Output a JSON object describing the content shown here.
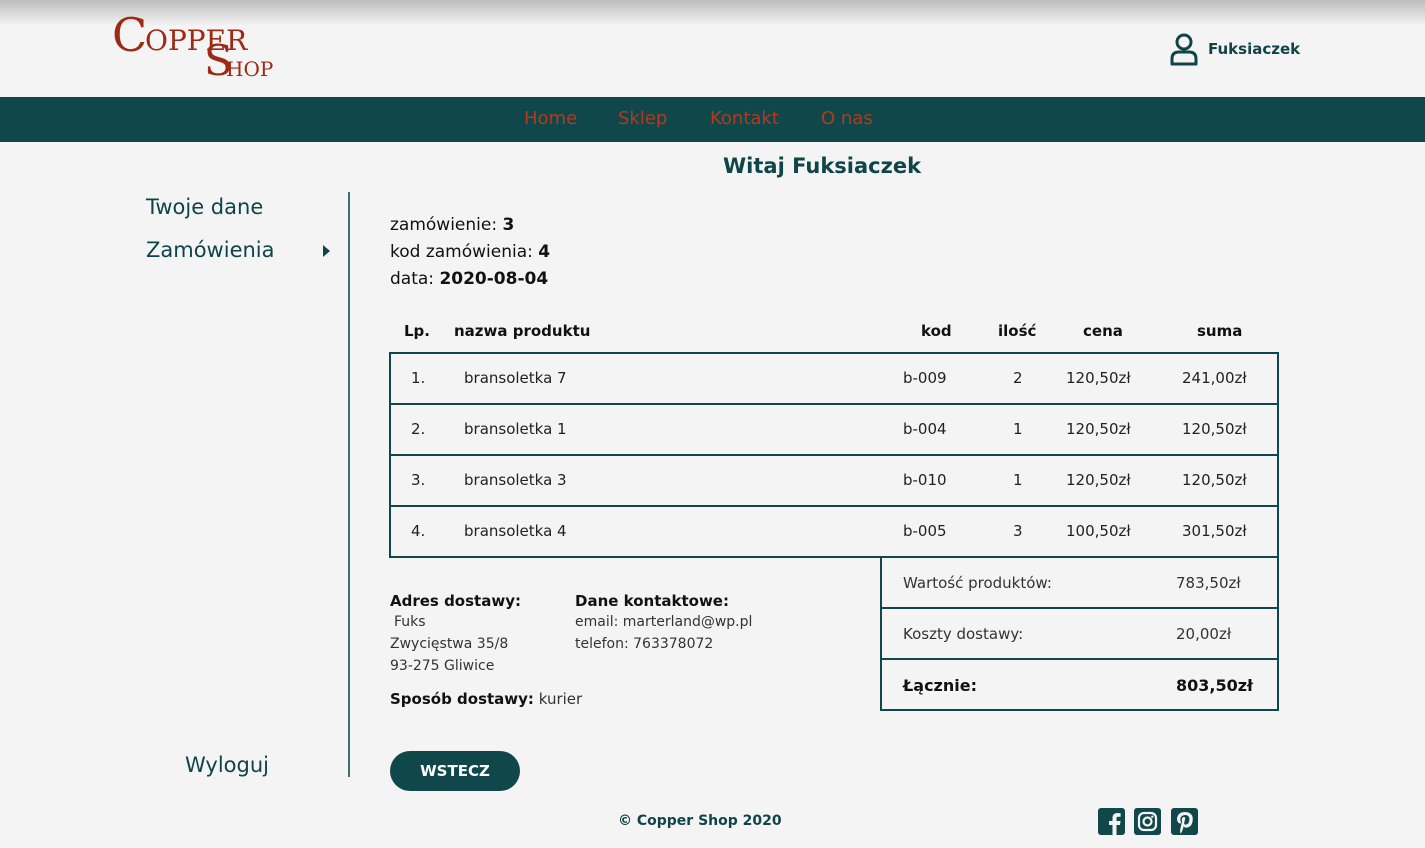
{
  "brand": {
    "logo_c": "C",
    "logo_opper": "OPPER",
    "logo_s": "S",
    "logo_hop": "HOP"
  },
  "header": {
    "username": "Fuksiaczek"
  },
  "nav": [
    "Home",
    "Sklep",
    "Kontakt",
    "O nas"
  ],
  "welcome": "Witaj Fuksiaczek",
  "sidebar": {
    "items": [
      "Twoje dane",
      "Zamówienia"
    ],
    "logout": "Wyloguj"
  },
  "order": {
    "number_label": "zamówienie:",
    "number": "3",
    "code_label": "kod zamówienia:",
    "code": "4",
    "date_label": "data:",
    "date": "2020-08-04"
  },
  "table": {
    "headers": {
      "lp": "Lp.",
      "name": "nazwa produktu",
      "code": "kod",
      "qty": "ilość",
      "price": "cena",
      "sum": "suma"
    },
    "rows": [
      {
        "lp": "1.",
        "name": "bransoletka 7",
        "code": "b-009",
        "qty": "2",
        "price": "120,50zł",
        "sum": "241,00zł"
      },
      {
        "lp": "2.",
        "name": "bransoletka 1",
        "code": "b-004",
        "qty": "1",
        "price": "120,50zł",
        "sum": "120,50zł"
      },
      {
        "lp": "3.",
        "name": "bransoletka 3",
        "code": "b-010",
        "qty": "1",
        "price": "120,50zł",
        "sum": "120,50zł"
      },
      {
        "lp": "4.",
        "name": "bransoletka 4",
        "code": "b-005",
        "qty": "3",
        "price": "100,50zł",
        "sum": "301,50zł"
      }
    ]
  },
  "summary": {
    "products_label": "Wartość produktów:",
    "products_value": "783,50zł",
    "shipping_label": "Koszty dostawy:",
    "shipping_value": "20,00zł",
    "total_label": "Łącznie:",
    "total_value": "803,50zł"
  },
  "address": {
    "title": "Adres dostawy:",
    "name": "Fuks",
    "street": "Zwycięstwa 35/8",
    "city": "93-275 Gliwice"
  },
  "contact": {
    "title": "Dane kontaktowe:",
    "email": "email: marterland@wp.pl",
    "phone": "telefon: 763378072"
  },
  "delivery": {
    "label": "Sposób dostawy:",
    "method": "kurier"
  },
  "back_button": "WSTECZ",
  "footer": {
    "copyright": "© Copper Shop 2020",
    "social_icons": [
      "facebook-icon",
      "instagram-icon",
      "pinterest-icon"
    ]
  },
  "colors": {
    "primary": "#10474b",
    "accent": "#b33a1c",
    "background": "#f4f4f4"
  }
}
